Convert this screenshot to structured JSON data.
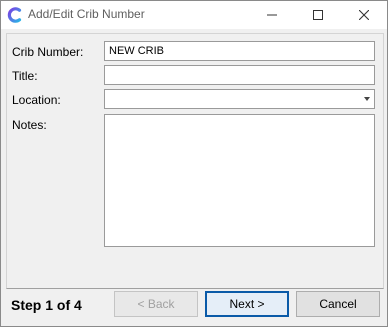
{
  "window": {
    "title": "Add/Edit Crib Number",
    "controls": [
      "minimize-icon",
      "maximize-icon",
      "close-icon"
    ]
  },
  "form": {
    "crib_number_label": "Crib Number:",
    "crib_number_value": "NEW CRIB",
    "title_label": "Title:",
    "title_value": "",
    "location_label": "Location:",
    "location_value": "",
    "notes_label": "Notes:",
    "notes_value": ""
  },
  "footer": {
    "step_text": "Step 1 of 4",
    "back_label": "< Back",
    "next_label": "Next >",
    "cancel_label": "Cancel"
  },
  "colors": {
    "default_button_border": "#0a5aa8",
    "icon_gradient_start": "#7b3fe4",
    "icon_gradient_end": "#2bb3e6"
  }
}
